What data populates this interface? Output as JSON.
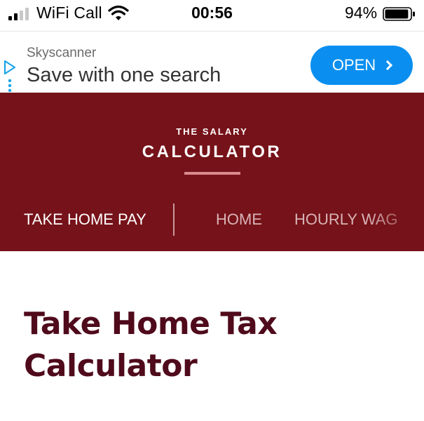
{
  "status_bar": {
    "carrier": "WiFi Call",
    "time": "00:56",
    "battery_percent": "94%",
    "battery_level": 0.94,
    "signal_bars": 2,
    "icons": [
      "signal-icon",
      "wifi-icon",
      "battery-icon"
    ]
  },
  "ad": {
    "brand": "Skyscanner",
    "headline": "Save with one search",
    "cta_label": "OPEN",
    "cta_color": "#0a8ff0",
    "icons": [
      "ad-choices-icon",
      "chevron-right-icon"
    ]
  },
  "header": {
    "logo_top": "THE SALARY",
    "logo_main": "CALCULATOR",
    "background_color": "#761219",
    "nav": {
      "active": "TAKE HOME PAY",
      "items": [
        "HOME",
        "HOURLY WAG"
      ]
    }
  },
  "main": {
    "title": "Take Home Tax Calculator",
    "title_color": "#4f0a1b"
  }
}
